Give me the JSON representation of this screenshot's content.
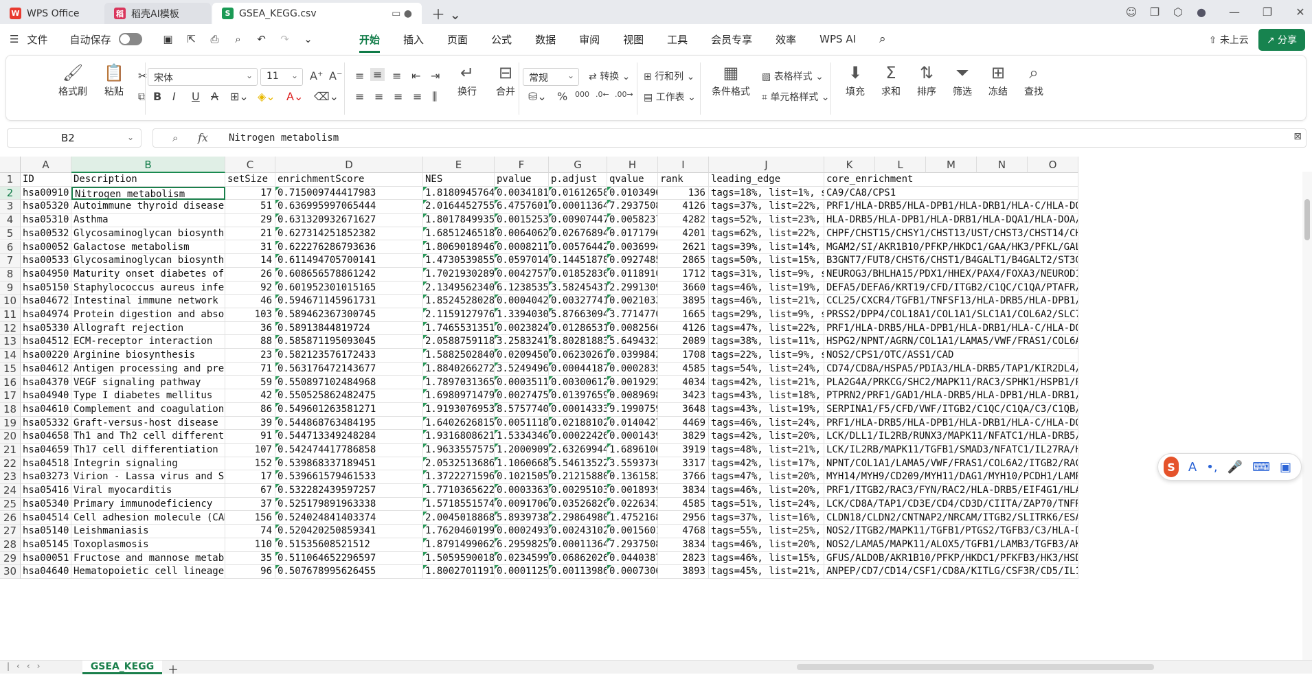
{
  "titlebar": {
    "tabs": [
      {
        "label": "WPS Office"
      },
      {
        "label": "稻壳AI模板"
      },
      {
        "label": "GSEA_KEGG.csv"
      }
    ]
  },
  "menubar": {
    "file": "文件",
    "autosave": "自动保存",
    "menus": [
      "开始",
      "插入",
      "页面",
      "公式",
      "数据",
      "审阅",
      "视图",
      "工具",
      "会员专享",
      "效率",
      "WPS AI"
    ],
    "cloud": "未上云",
    "share": "分享"
  },
  "ribbon": {
    "format_painter": "格式刷",
    "paste": "粘贴",
    "font": "宋体",
    "font_size": "11",
    "wrap": "换行",
    "merge": "合并",
    "number_format": "常规",
    "convert": "转换",
    "row_col": "行和列",
    "worksheet": "工作表",
    "cond_format": "条件格式",
    "table_style": "表格样式",
    "cell_style": "单元格样式",
    "fill": "填充",
    "sum": "求和",
    "sort": "排序",
    "filter": "筛选",
    "freeze": "冻结",
    "find": "查找"
  },
  "formula_bar": {
    "cell_ref": "B2",
    "value": "Nitrogen metabolism"
  },
  "columns": [
    "A",
    "B",
    "C",
    "D",
    "E",
    "F",
    "G",
    "H",
    "I",
    "J",
    "K",
    "L",
    "M",
    "N",
    "O"
  ],
  "header_row": [
    "ID",
    "Description",
    "setSize",
    "enrichmentScore",
    "NES",
    "pvalue",
    "p.adjust",
    "qvalue",
    "rank",
    "leading_edge",
    "core_enrichment"
  ],
  "rows": [
    [
      "hsa00910",
      "Nitrogen metabolism",
      "17",
      "0.715009744417983",
      "1.81809457643",
      "0.0034181",
      "0.016126583",
      "0.0103496",
      "136",
      "tags=18%, list=1%, sig",
      "CA9/CA8/CPS1"
    ],
    [
      "hsa05320",
      "Autoimmune thyroid disease",
      "51",
      "0.636995997065444",
      "2.01644527555",
      "6.47576012",
      "0.000113649",
      "7.29375087",
      "4126",
      "tags=37%, list=22%, si",
      "PRF1/HLA-DRB5/HLA-DPB1/HLA-DRB1/HLA-C/HLA-DQA1/H"
    ],
    [
      "hsa05310",
      "Asthma",
      "29",
      "0.631320932671627",
      "1.80178499352",
      "0.00152533",
      "0.009074476",
      "0.00582377",
      "4282",
      "tags=52%, list=23%, si",
      "HLA-DRB5/HLA-DPB1/HLA-DRB1/HLA-DQA1/HLA-DOA/HLA-"
    ],
    [
      "hsa00532",
      "Glycosaminoglycan biosynthesis",
      "21",
      "0.627314251852382",
      "1.68512465189",
      "0.00640624",
      "0.026768943",
      "0.01717964",
      "4201",
      "tags=62%, list=22%, si",
      "CHPF/CHST15/CHSY1/CHST13/UST/CHST3/CHST14/CHST11"
    ],
    [
      "hsa00052",
      "Galactose metabolism",
      "31",
      "0.622276286793636",
      "1.80690189462",
      "0.00082114",
      "0.005764429",
      "0.00369946",
      "2621",
      "tags=39%, list=14%, si",
      "MGAM2/SI/AKR1B10/PFKP/HKDC1/GAA/HK3/PFKL/GALK1/H"
    ],
    [
      "hsa00533",
      "Glycosaminoglycan biosynthesis",
      "14",
      "0.611494705700141",
      "1.47305398559",
      "0.05970149",
      "0.144518785",
      "0.09274859",
      "2865",
      "tags=50%, list=15%, si",
      "B3GNT7/FUT8/CHST6/CHST1/B4GALT1/B4GALT2/ST3GAL2"
    ],
    [
      "hsa04950",
      "Maturity onset diabetes of the",
      "26",
      "0.608656578861242",
      "1.70219302891",
      "0.00427577",
      "0.018528361",
      "0.01189104",
      "1712",
      "tags=31%, list=9%, sig",
      "NEUROG3/BHLHA15/PDX1/HHEX/PAX4/FOXA3/NEUROD1/RFX"
    ],
    [
      "hsa05150",
      "Staphylococcus aureus infectio",
      "92",
      "0.601952301015165",
      "2.13495623404",
      "6.12385352",
      "3.582454314",
      "2.29913097",
      "3660",
      "tags=46%, list=19%, si",
      "DEFA5/DEFA6/KRT19/CFD/ITGB2/C1QC/C1QA/PTAFR/C1QB"
    ],
    [
      "hsa04672",
      "Intestinal immune network for",
      "46",
      "0.594671145961731",
      "1.85245280284",
      "0.00040424",
      "0.003277417",
      "0.00210336",
      "3895",
      "tags=46%, list=21%, si",
      "CCL25/CXCR4/TGFB1/TNFSF13/HLA-DRB5/HLA-DPB1/HLA-"
    ],
    [
      "hsa04974",
      "Protein digestion and absorpti",
      "103",
      "0.589462367300745",
      "2.11591279767",
      "1.33940306",
      "5.876630948",
      "3.77147705",
      "1665",
      "tags=29%, list=9%, sig",
      "PRSS2/DPP4/COL18A1/COL1A1/SLC1A1/COL6A2/SLC7A9/M"
    ],
    [
      "hsa05330",
      "Allograft rejection",
      "36",
      "0.58913844819724",
      "1.74655313516",
      "0.00238246",
      "0.012865319",
      "0.00825664",
      "4126",
      "tags=47%, list=22%, si",
      "PRF1/HLA-DRB5/HLA-DPB1/HLA-DRB1/HLA-C/HLA-DQA1/H"
    ],
    [
      "hsa04512",
      "ECM-receptor interaction",
      "88",
      "0.585871195093045",
      "2.05887591187",
      "3.25832418",
      "8.802818831",
      "5.64943238",
      "2089",
      "tags=38%, list=11%, si",
      "HSPG2/NPNT/AGRN/COL1A1/LAMA5/VWF/FRAS1/COL6A2/IT"
    ],
    [
      "hsa00220",
      "Arginine biosynthesis",
      "23",
      "0.582123576172433",
      "1.58825028407",
      "0.02094503",
      "0.062302613",
      "0.03998428",
      "1708",
      "tags=22%, list=9%, sig",
      "NOS2/CPS1/OTC/ASS1/CAD"
    ],
    [
      "hsa04612",
      "Antigen processing and present",
      "71",
      "0.563176472143677",
      "1.88402662722",
      "3.52494966",
      "0.000441877",
      "0.00028358",
      "4585",
      "tags=54%, list=24%, si",
      "CD74/CD8A/HSPA5/PDIA3/HLA-DRB5/TAP1/KIR2DL4/CD4/"
    ],
    [
      "hsa04370",
      "VEGF signaling pathway",
      "59",
      "0.550897102484968",
      "1.78970313659",
      "0.00035114",
      "0.003006126",
      "0.00192925",
      "4034",
      "tags=42%, list=21%, si",
      "PLA2G4A/PRKCG/SHC2/MAPK11/RAC3/SPHK1/HSPB1/PTGS2"
    ],
    [
      "hsa04940",
      "Type I diabetes mellitus",
      "42",
      "0.550525862482475",
      "1.69809714797",
      "0.00274753",
      "0.013976596",
      "0.00896983",
      "3423",
      "tags=43%, list=18%, si",
      "PTPRN2/PRF1/GAD1/HLA-DRB5/HLA-DPB1/HLA-DRB1/HLA-"
    ],
    [
      "hsa04610",
      "Complement and coagulation cas",
      "86",
      "0.549601263581271",
      "1.91930769533",
      "8.57577403",
      "0.000143337",
      "9.19907591",
      "3648",
      "tags=43%, list=19%, si",
      "SERPINA1/F5/CFD/VWF/ITGB2/C1QC/C1QA/C3/C1QB/F12"
    ],
    [
      "hsa05332",
      "Graft-versus-host disease",
      "39",
      "0.544868763484195",
      "1.64026268156",
      "0.00511180",
      "0.021881028",
      "0.01404270",
      "4469",
      "tags=46%, list=24%, si",
      "PRF1/HLA-DRB5/HLA-DPB1/HLA-DRB1/HLA-C/HLA-DQA1/H"
    ],
    [
      "hsa04658",
      "Th1 and Th2 cell differentiati",
      "91",
      "0.544713349248284",
      "1.93168086216",
      "1.53343464",
      "0.000224264",
      "0.00014392",
      "3829",
      "tags=42%, list=20%, si",
      "LCK/DLL1/IL2RB/RUNX3/MAPK11/NFATC1/HLA-DRB5/MAPK"
    ],
    [
      "hsa04659",
      "Th17 cell differentiation",
      "107",
      "0.542474417786858",
      "1.96335575757",
      "1.20009091",
      "2.632699441",
      "1.68961068",
      "3919",
      "tags=48%, list=21%, si",
      "LCK/IL2RB/MAPK11/TGFB1/SMAD3/NFATC1/IL27RA/HLA-D"
    ],
    [
      "hsa04518",
      "Integrin signaling",
      "152",
      "0.539868337189451",
      "2.05325136866",
      "1.10606685",
      "5.546135220",
      "3.55937303",
      "3317",
      "tags=42%, list=17%, si",
      "NPNT/COL1A1/LAMA5/VWF/FRAS1/COL6A2/ITGB2/RAC3/TG"
    ],
    [
      "hsa03273",
      "Virion - Lassa virus and SFTS",
      "17",
      "0.539661579461533",
      "1.37222715968",
      "0.10215053",
      "0.212158808",
      "0.13615829",
      "3766",
      "tags=47%, list=20%, si",
      "MYH14/MYH9/CD209/MYH11/DAG1/MYH10/PCDH1/LAMP1"
    ],
    [
      "hsa05416",
      "Viral myocarditis",
      "67",
      "0.532282439597257",
      "1.77103656223",
      "0.00033630",
      "0.002951034",
      "0.00189390",
      "3834",
      "tags=46%, list=20%, si",
      "PRF1/ITGB2/RAC3/FYN/RAC2/HLA-DRB5/EIF4G1/HLA-DPB"
    ],
    [
      "hsa05340",
      "Primary immunodeficiency",
      "37",
      "0.525179891963338",
      "1.57185515744",
      "0.00917066",
      "0.035268265",
      "0.02263430",
      "4585",
      "tags=51%, list=24%, si",
      "LCK/CD8A/TAP1/CD3E/CD4/CD3D/CIITA/ZAP70/TNFRSF13"
    ],
    [
      "hsa04514",
      "Cell adhesion molecule (CAM) i",
      "156",
      "0.524024841403374",
      "2.00450188685",
      "5.89397385",
      "2.298649803",
      "1.47521684",
      "2956",
      "tags=37%, list=16%, si",
      "CLDN18/CLDN2/CNTNAP2/NRCAM/ITGB2/SLITRK6/ESAM/PT"
    ],
    [
      "hsa05140",
      "Leishmaniasis",
      "74",
      "0.520420250859341",
      "1.76204601999",
      "0.00024933",
      "0.002431024",
      "0.00156017",
      "4768",
      "tags=55%, list=25%, si",
      "NOS2/ITGB2/MAPK11/TGFB1/PTGS2/TGFB3/C3/HLA-DRB5/"
    ],
    [
      "hsa05145",
      "Toxoplasmosis",
      "110",
      "0.51535608521512",
      "1.87914990625",
      "6.29598258",
      "0.000113649",
      "7.29375087",
      "3834",
      "tags=46%, list=20%, si",
      "NOS2/LAMA5/MAPK11/ALOX5/TGFB1/LAMB3/TGFB3/AKT1/H"
    ],
    [
      "hsa00051",
      "Fructose and mannose metabolis",
      "35",
      "0.511064652296597",
      "1.50595900182",
      "0.02345992",
      "0.068620268",
      "0.04403879",
      "2823",
      "tags=46%, list=15%, si",
      "GFUS/ALDOB/AKR1B10/PFKP/HKDC1/PFKFB3/HK3/HSD17B1"
    ],
    [
      "hsa04640",
      "Hematopoietic cell lineage",
      "96",
      "0.507678995626455",
      "1.80027011915",
      "0.00011259",
      "0.001139868",
      "0.00073065",
      "3893",
      "tags=45%, list=21%, si",
      "ANPEP/CD7/CD14/CSF1/CD8A/KITLG/CSF3R/CD5/IL1R2/C"
    ]
  ],
  "sheet": {
    "name": "GSEA_KEGG"
  }
}
